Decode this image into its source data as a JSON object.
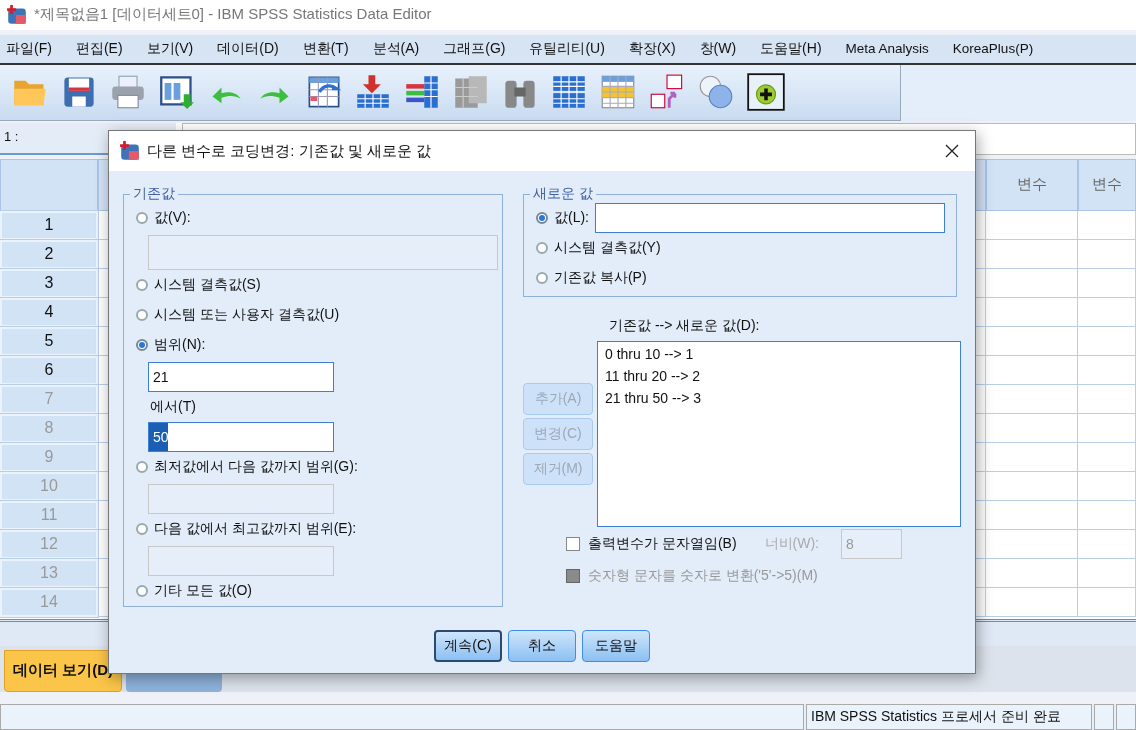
{
  "window": {
    "title": "*제목없음1 [데이터세트0] - IBM SPSS Statistics Data Editor"
  },
  "menu": [
    "파일(F)",
    "편집(E)",
    "보기(V)",
    "데이터(D)",
    "변환(T)",
    "분석(A)",
    "그래프(G)",
    "유틸리티(U)",
    "확장(X)",
    "창(W)",
    "도움말(H)",
    "Meta Analysis",
    "KoreaPlus(P)"
  ],
  "toolbar": [
    {
      "kind": "folder"
    },
    {
      "kind": "save"
    },
    {
      "kind": "print"
    },
    {
      "kind": "goto"
    },
    {
      "kind": "undo"
    },
    {
      "kind": "redo"
    },
    {
      "kind": "recall"
    },
    {
      "kind": "insert"
    },
    {
      "kind": "bars"
    },
    {
      "kind": "mu"
    },
    {
      "kind": "find"
    },
    {
      "kind": "split"
    },
    {
      "kind": "highlight"
    },
    {
      "kind": "labels"
    },
    {
      "kind": "sets"
    },
    {
      "kind": "extension"
    }
  ],
  "cell_ref": "1 :",
  "grid": {
    "columns": [
      "변수",
      "변수"
    ],
    "rows": [
      {
        "label": "1",
        "filled": true
      },
      {
        "label": "2",
        "filled": true
      },
      {
        "label": "3",
        "filled": true
      },
      {
        "label": "4",
        "filled": true
      },
      {
        "label": "5",
        "filled": true
      },
      {
        "label": "6",
        "filled": true
      },
      {
        "label": "7",
        "filled": false
      },
      {
        "label": "8",
        "filled": false
      },
      {
        "label": "9",
        "filled": false
      },
      {
        "label": "10",
        "filled": false
      },
      {
        "label": "11",
        "filled": false
      },
      {
        "label": "12",
        "filled": false
      },
      {
        "label": "13",
        "filled": false
      },
      {
        "label": "14",
        "filled": false
      }
    ]
  },
  "view_tabs": [
    {
      "label": "데이터 보기(D)",
      "selected": true
    },
    {
      "selected": false
    }
  ],
  "status_bar": "IBM SPSS Statistics 프로세서 준비 완료",
  "dialog": {
    "title": "다른 변수로 코딩변경: 기존값 및 새로운 값",
    "old_value": {
      "legend": "기존값",
      "items": [
        {
          "kind": "radio",
          "label": "값(V):",
          "selected": false
        },
        {
          "kind": "wide_field",
          "disabled": true,
          "text_selected": false
        },
        {
          "kind": "radio",
          "label": "시스템 결측값(S)",
          "selected": false
        },
        {
          "kind": "radio",
          "label": "시스템 또는 사용자 결측값(U)",
          "selected": false
        },
        {
          "kind": "radio",
          "label": "범위(N):",
          "selected": true
        },
        {
          "kind": "field",
          "value": "21",
          "disabled": false,
          "text_selected": false
        },
        {
          "kind": "caption",
          "label": "에서(T)"
        },
        {
          "kind": "field",
          "value": "50",
          "disabled": false,
          "text_selected": true
        },
        {
          "kind": "radio",
          "label": "최저값에서 다음 값까지 범위(G):",
          "selected": false
        },
        {
          "kind": "field",
          "disabled": true,
          "text_selected": false
        },
        {
          "kind": "radio",
          "label": "다음 값에서 최고값까지 범위(E):",
          "selected": false
        },
        {
          "kind": "field",
          "disabled": true,
          "text_selected": false
        },
        {
          "kind": "radio",
          "label": "기타 모든 값(O)",
          "selected": false
        }
      ]
    },
    "new_value": {
      "legend": "새로운 값",
      "items": [
        {
          "kind": "radio_field",
          "label": "값(L):",
          "selected": true
        },
        {
          "kind": "radio",
          "label": "시스템 결측값(Y)",
          "selected": false
        },
        {
          "kind": "radio",
          "label": "기존값 복사(P)",
          "selected": false
        }
      ]
    },
    "list_label": "기존값 --> 새로운 값(D):",
    "list_items": [
      "0 thru 10 --> 1",
      "11 thru 20 --> 2",
      "21 thru 50 --> 3"
    ],
    "list_buttons": [
      {
        "label": "추가(A)",
        "disabled": true
      },
      {
        "label": "변경(C)",
        "disabled": true
      },
      {
        "label": "제거(M)",
        "disabled": true
      }
    ],
    "checks": [
      {
        "label": "출력변수가 문자열임(B)",
        "checked": false,
        "disabled": false
      },
      {
        "label": "숫자형 문자를 숫자로 변환('5'->5)(M)",
        "checked": false,
        "disabled": true
      }
    ],
    "width": {
      "label": "너비(W):",
      "value": "8",
      "disabled": true
    },
    "buttons": [
      {
        "label": "계속(C)",
        "default": true
      },
      {
        "label": "취소",
        "default": false
      },
      {
        "label": "도움말",
        "default": false
      }
    ]
  }
}
